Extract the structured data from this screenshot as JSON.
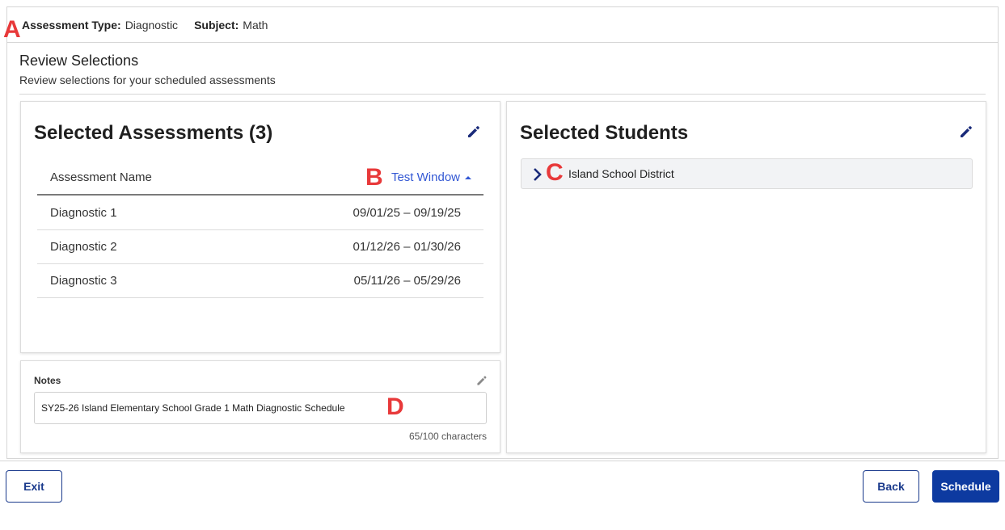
{
  "header": {
    "assessment_type_label": "Assessment Type:",
    "assessment_type_value": "Diagnostic",
    "subject_label": "Subject:",
    "subject_value": "Math"
  },
  "review": {
    "title": "Review Selections",
    "subtitle": "Review selections for your scheduled assessments"
  },
  "assessments": {
    "title": "Selected Assessments (3)",
    "col_name": "Assessment Name",
    "col_window": "Test Window",
    "rows": [
      {
        "name": "Diagnostic 1",
        "window": "09/01/25 – 09/19/25"
      },
      {
        "name": "Diagnostic 2",
        "window": "01/12/26 – 01/30/26"
      },
      {
        "name": "Diagnostic 3",
        "window": "05/11/26 – 05/29/26"
      }
    ]
  },
  "notes": {
    "label": "Notes",
    "value": "SY25-26 Island Elementary School Grade 1 Math Diagnostic Schedule",
    "count": "65/100 characters"
  },
  "students": {
    "title": "Selected Students",
    "district": "Island School District"
  },
  "footer": {
    "exit_label": "Exit",
    "back_label": "Back",
    "schedule_label": "Schedule"
  },
  "markers": {
    "a": "A",
    "b": "B",
    "c": "C",
    "d": "D"
  },
  "colors": {
    "accent": "#0d3aa0",
    "link": "#3358d4",
    "icon": "#1a2b7a",
    "marker": "#e8393a"
  },
  "icons": {
    "edit": "pencil-icon",
    "sort": "caret-up-icon",
    "expand": "chevron-right-icon"
  }
}
